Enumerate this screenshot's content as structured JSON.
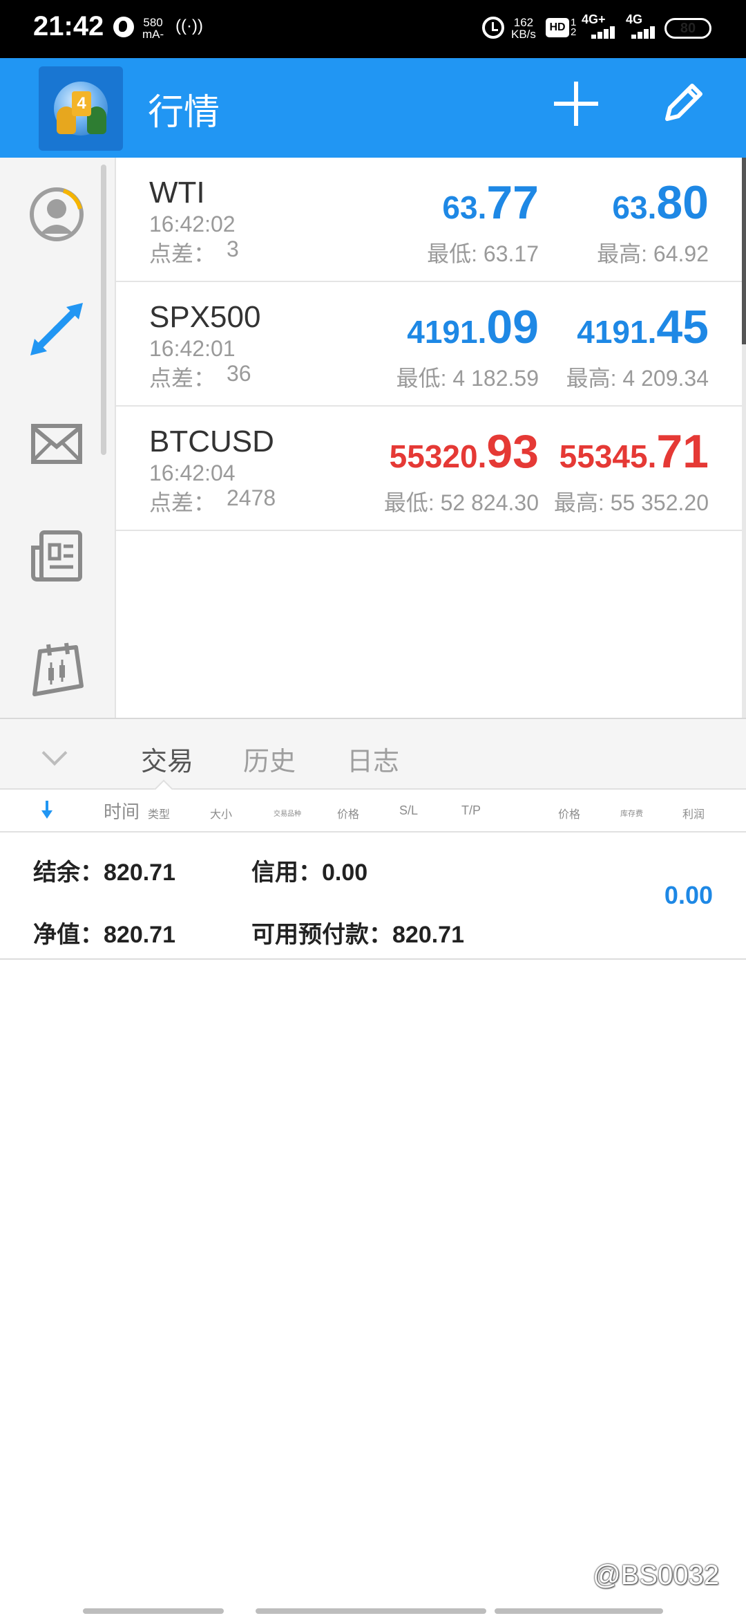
{
  "status_bar": {
    "time": "21:42",
    "current_value": "580",
    "current_unit": "mA-",
    "speed_value": "162",
    "speed_unit": "KB/s",
    "hd_label": "HD",
    "hd_sub_top": "1",
    "hd_sub_bottom": "2",
    "net1": "4G+",
    "net2": "4G",
    "battery": "80"
  },
  "app_bar": {
    "logo_number": "4",
    "title": "行情"
  },
  "sidebar": {
    "items": [
      "account-icon",
      "trade-arrows-icon",
      "mail-icon",
      "news-icon",
      "calendar-icon"
    ],
    "accent_color": "#2196f3"
  },
  "quotes": [
    {
      "symbol": "WTI",
      "time": "16:42:02",
      "spread_label": "点差：",
      "spread": "3",
      "bid_small": "63.",
      "bid_big": "77",
      "ask_small": "63.",
      "ask_big": "80",
      "low": "最低: 63.17",
      "high": "最高: 64.92",
      "color": "#1e88e5"
    },
    {
      "symbol": "SPX500",
      "time": "16:42:01",
      "spread_label": "点差：",
      "spread": "36",
      "bid_small": "4191.",
      "bid_big": "09",
      "ask_small": "4191.",
      "ask_big": "45",
      "low": "最低: 4 182.59",
      "high": "最高: 4 209.34",
      "color": "#1e88e5"
    },
    {
      "symbol": "BTCUSD",
      "time": "16:42:04",
      "spread_label": "点差：",
      "spread": "2478",
      "bid_small": "55320.",
      "bid_big": "93",
      "ask_small": "55345.",
      "ask_big": "71",
      "low": "最低: 52 824.30",
      "high": "最高: 55 352.20",
      "color": "#e53935"
    }
  ],
  "terminal": {
    "tabs": [
      "交易",
      "历史",
      "日志"
    ],
    "active_tab": 0,
    "columns": [
      "时间",
      "类型",
      "大小",
      "交易品种",
      "价格",
      "S/L",
      "T/P",
      "价格",
      "库存费",
      "利润"
    ],
    "account": {
      "balance": "结余：820.71",
      "credit": "信用：0.00",
      "equity": "净值：820.71",
      "free_margin": "可用预付款：820.71",
      "profit": "0.00"
    }
  },
  "watermark": "@BS0032"
}
